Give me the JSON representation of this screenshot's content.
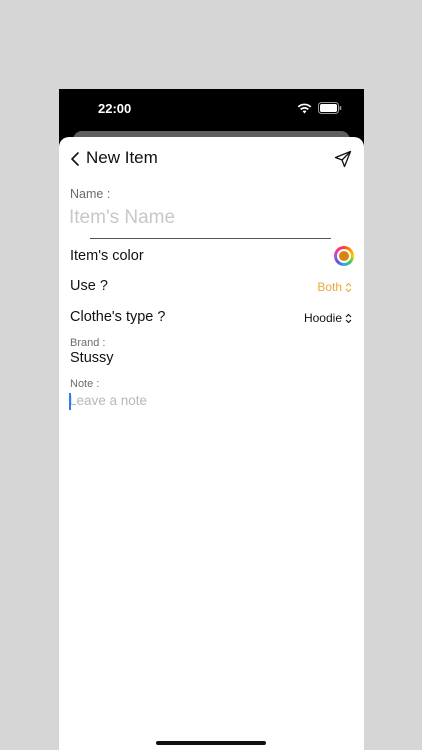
{
  "status_bar": {
    "time": "22:00"
  },
  "nav": {
    "title": "New Item"
  },
  "name_field": {
    "label": "Name :",
    "placeholder": "Item's Name"
  },
  "color_row": {
    "label": "Item's color",
    "selected_color": "#d4860f"
  },
  "use_row": {
    "label": "Use ?",
    "value": "Both",
    "value_color": "#f0a732"
  },
  "type_row": {
    "label": "Clothe's type ?",
    "value": "Hoodie"
  },
  "brand": {
    "label": "Brand :",
    "value": "Stussy"
  },
  "note": {
    "label": "Note :",
    "placeholder": "Leave a note"
  },
  "icons": {
    "back": "chevron-left-icon",
    "send": "paper-plane-icon",
    "wifi": "wifi-icon",
    "battery": "battery-icon",
    "picker": "chevron-up-down-icon"
  }
}
